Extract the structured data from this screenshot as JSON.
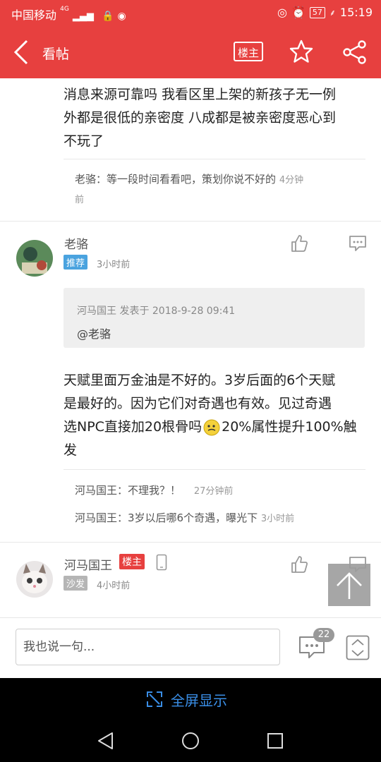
{
  "status_bar": {
    "carrier": "中国移动",
    "net": "4G",
    "battery": "57",
    "time": "15:19"
  },
  "header": {
    "title": "看帖",
    "owner_button": "楼主"
  },
  "post_top": {
    "text_lines": [
      "消息来源可靠吗 我看区里上架的新孩子无一例",
      "外都是很低的亲密度 八成都是被亲密度恶心到",
      "不玩了"
    ],
    "reply": {
      "user": "老骆：",
      "text": "等一段时间看看吧，策划你说不好的",
      "time_a": "4分钟",
      "time_b": "前"
    }
  },
  "comment1": {
    "user": "老骆",
    "badge": "推荐",
    "time": "3小时前",
    "quote_meta": "河马国王 发表于 2018-9-28 09:41",
    "quote_text": "@老骆",
    "text_lines": [
      "天赋里面万金油是不好的。3岁后面的6个天赋",
      "是最好的。因为它们对奇遇也有效。见过奇遇",
      "选NPC直接加20根骨吗",
      "20%属性提升100%触",
      "发"
    ],
    "replies": [
      {
        "user": "河马国王：",
        "text": "不理我？！",
        "time": "27分钟前"
      },
      {
        "user": "河马国王：",
        "text": "3岁以后哪6个奇遇，曝光下",
        "time": "3小时前"
      }
    ]
  },
  "comment2": {
    "user": "河马国王",
    "owner_badge": "楼主",
    "floor_badge": "沙发",
    "time": "4小时前"
  },
  "input_bar": {
    "placeholder": "我也说一句...",
    "comment_count": "22"
  },
  "fullscreen_label": "全屏显示",
  "colors": {
    "header_red": "#e7403f",
    "recommend_blue": "#4aa3df",
    "owner_red": "#e7403f",
    "sofa_grey": "#b5b5b5",
    "link_blue": "#3a8ee6"
  }
}
